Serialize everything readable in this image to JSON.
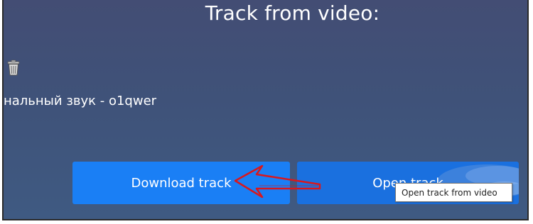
{
  "section_title": "Track from video:",
  "track": {
    "name": "нальный звук - o1qwer",
    "delete_icon": "trash-icon"
  },
  "buttons": {
    "download": "Download track",
    "open": "Open track"
  },
  "tooltip": "Open track from video",
  "annotation": {
    "arrow_icon": "red-arrow-icon",
    "arrow_color": "#d8181e"
  },
  "colors": {
    "background": "#3f5279",
    "download_button": "#1a7ff5",
    "open_button": "#1a70df"
  }
}
